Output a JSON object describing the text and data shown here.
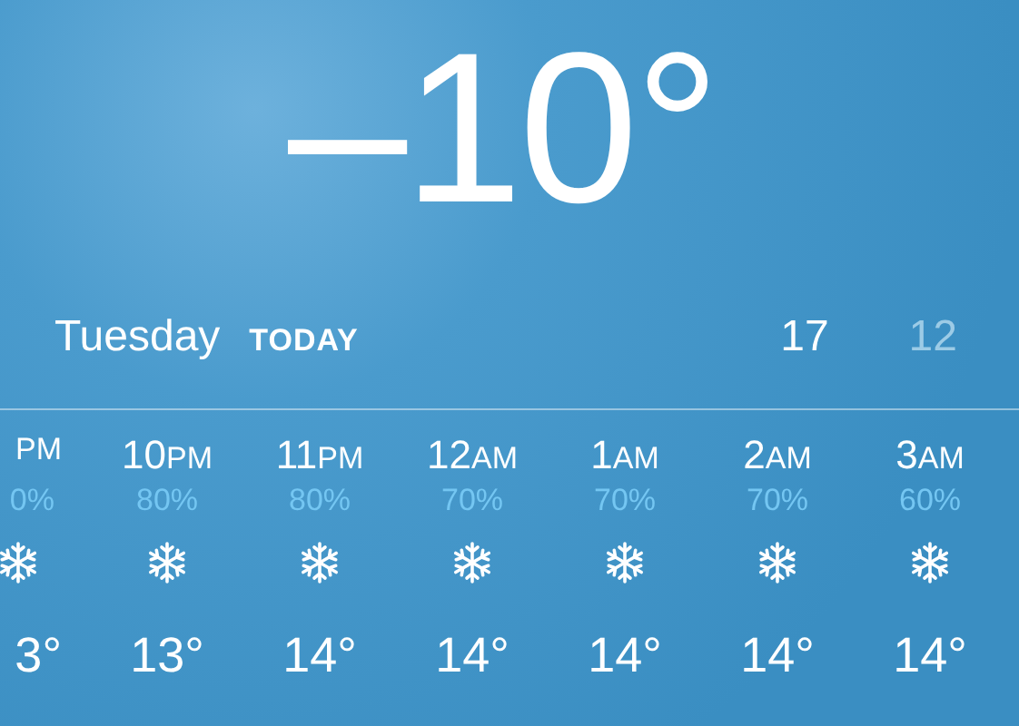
{
  "current": {
    "temperature": "–10°"
  },
  "today": {
    "day": "Tuesday",
    "label": "TODAY",
    "high": "17",
    "low": "12"
  },
  "hourly": [
    {
      "meridiem": "PM",
      "precip": "0%",
      "temp": "3°",
      "kind": "snow"
    },
    {
      "hour": "10",
      "meridiem": "PM",
      "precip": "80%",
      "temp": "13°",
      "kind": "snow"
    },
    {
      "hour": "11",
      "meridiem": "PM",
      "precip": "80%",
      "temp": "14°",
      "kind": "snow"
    },
    {
      "hour": "12",
      "meridiem": "AM",
      "precip": "70%",
      "temp": "14°",
      "kind": "snow"
    },
    {
      "hour": "1",
      "meridiem": "AM",
      "precip": "70%",
      "temp": "14°",
      "kind": "snow"
    },
    {
      "hour": "2",
      "meridiem": "AM",
      "precip": "70%",
      "temp": "14°",
      "kind": "snow"
    },
    {
      "hour": "3",
      "meridiem": "AM",
      "precip": "60%",
      "temp": "14°",
      "kind": "snow"
    }
  ]
}
